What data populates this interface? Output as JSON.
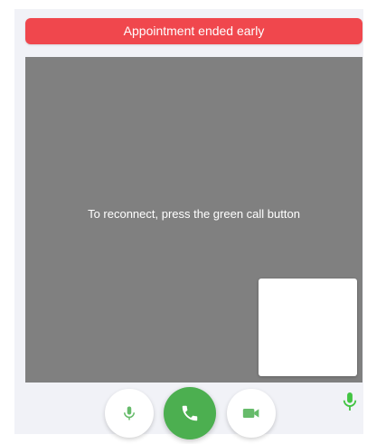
{
  "alert": {
    "text": "Appointment ended early",
    "color": "#f0474d"
  },
  "video": {
    "message": "To reconnect, press the green call button",
    "background": "#808080"
  },
  "controls": {
    "microphone": {
      "icon": "microphone-icon",
      "color": "#66bb6a"
    },
    "call": {
      "icon": "phone-icon",
      "color": "#4caf50"
    },
    "camera": {
      "icon": "video-camera-icon",
      "color": "#66bb6a"
    }
  },
  "mic_indicator": {
    "icon": "microphone-icon",
    "color": "#43c443"
  }
}
